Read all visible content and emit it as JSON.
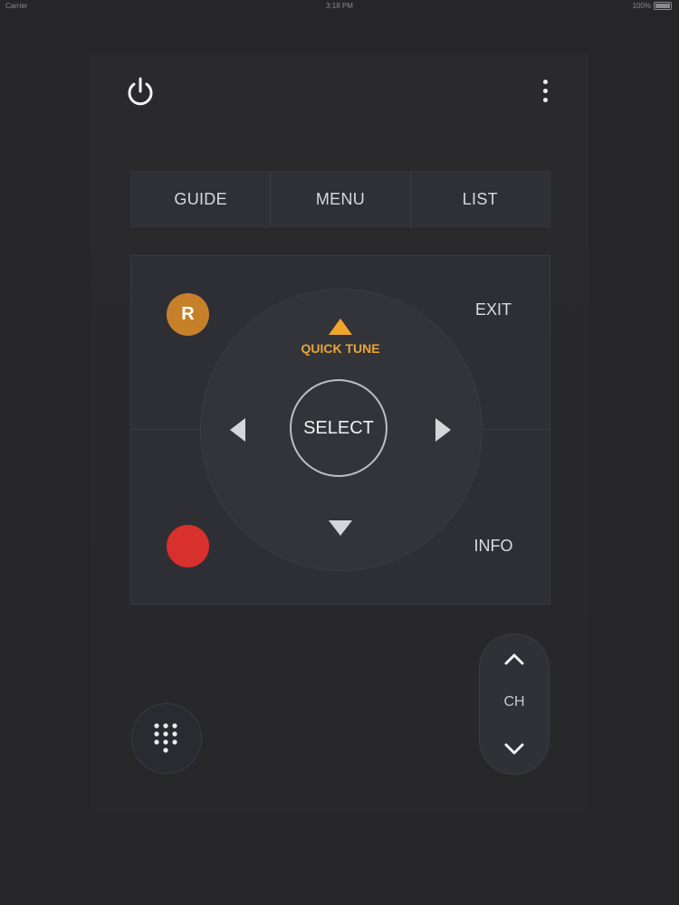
{
  "status_bar": {
    "carrier": "Carrier",
    "time": "3:18 PM",
    "battery": "100%"
  },
  "header": {
    "power_icon": "power-icon",
    "more_icon": "more-vertical-icon"
  },
  "top_row": {
    "guide_label": "GUIDE",
    "menu_label": "MENU",
    "list_label": "LIST"
  },
  "dpad": {
    "r_label": "R",
    "exit_label": "EXIT",
    "info_label": "INFO",
    "quick_tune_label": "QUICK TUNE",
    "select_label": "SELECT",
    "up_icon": "triangle-up-icon",
    "down_icon": "triangle-down-icon",
    "left_icon": "triangle-left-icon",
    "right_icon": "triangle-right-icon",
    "record_icon": "record-icon"
  },
  "bottom": {
    "keypad_icon": "keypad-icon",
    "ch_label": "CH",
    "ch_up_icon": "chevron-up-icon",
    "ch_down_icon": "chevron-down-icon"
  },
  "colors": {
    "background": "#262628",
    "panel": "#2e2f35",
    "accent_orange": "#e8a537",
    "r_button": "#c7802a",
    "record_red": "#d8302c"
  }
}
